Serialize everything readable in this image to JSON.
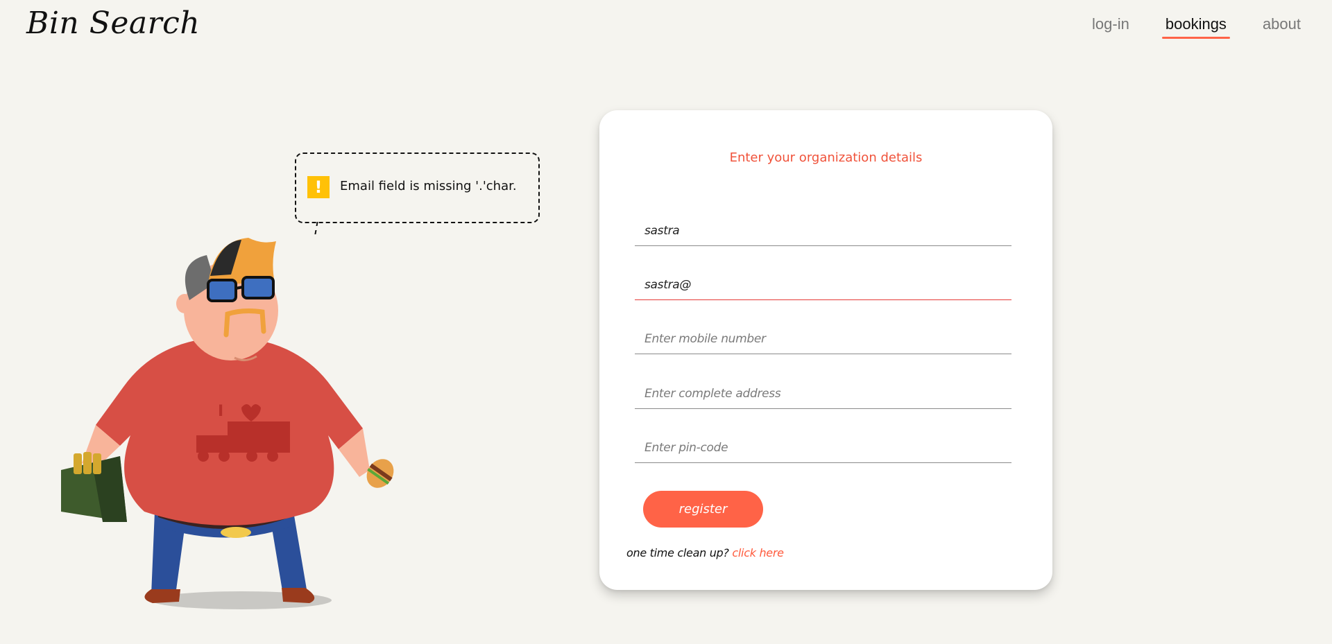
{
  "app": {
    "logo": "Bin Search"
  },
  "nav": {
    "items": [
      {
        "label": "log-in",
        "active": false
      },
      {
        "label": "bookings",
        "active": true
      },
      {
        "label": "about",
        "active": false
      }
    ]
  },
  "tooltip": {
    "icon": "warning-icon",
    "icon_glyph": "!",
    "message": "Email field is missing '.'char."
  },
  "form": {
    "title": "Enter your organization details",
    "fields": [
      {
        "value": "sastra",
        "placeholder": ""
      },
      {
        "value": "sastra@",
        "placeholder": "",
        "error": true
      },
      {
        "value": "",
        "placeholder": "Enter mobile number"
      },
      {
        "value": "",
        "placeholder": "Enter complete address"
      },
      {
        "value": "",
        "placeholder": "Enter pin-code"
      }
    ],
    "register_label": "register",
    "cleanup_prompt": "one time clean up?",
    "cleanup_link": "click here"
  },
  "colors": {
    "accent": "#ff6347",
    "background": "#f5f4ef",
    "warning": "#ffc107",
    "error": "#e53935"
  }
}
